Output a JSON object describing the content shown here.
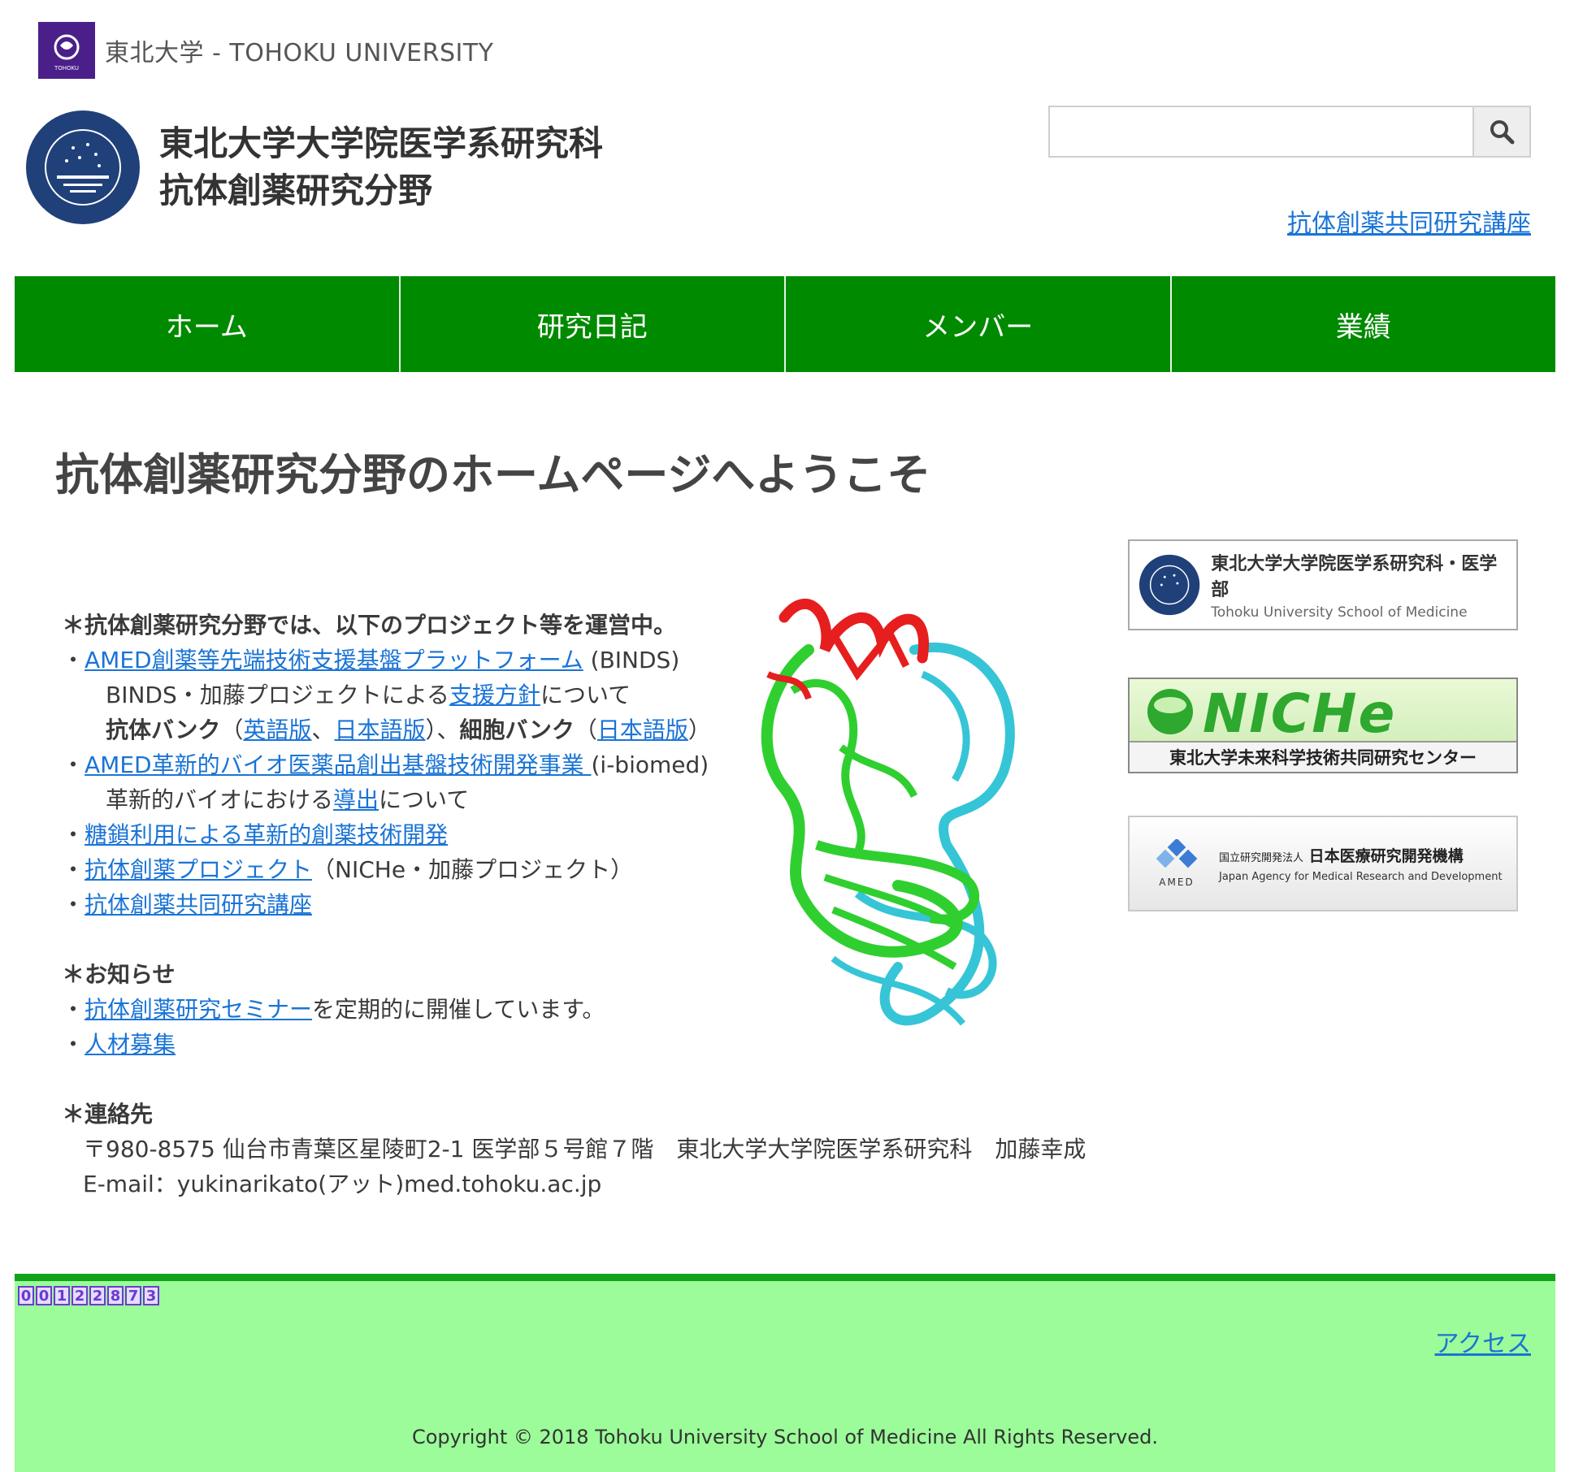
{
  "university": {
    "name": "東北大学 - TOHOKU UNIVERSITY",
    "logo_text": "TOHOKU"
  },
  "header": {
    "title_line1": "東北大学大学院医学系研究科",
    "title_line2": "抗体創薬研究分野",
    "search_placeholder": "",
    "search_value": "",
    "link": "抗体創薬共同研究講座"
  },
  "nav": [
    "ホーム",
    "研究日記",
    "メンバー",
    "業績"
  ],
  "welcome": "抗体創薬研究分野のホームページへようこそ",
  "projects": {
    "heading": "＊抗体創薬研究分野では、以下のプロジェクト等を運営中。",
    "binds_link": "AMED創薬等先端技術支援基盤プラットフォーム",
    "binds_suffix": " (BINDS)",
    "binds_sub_pre": "BINDS・加藤プロジェクトによる",
    "binds_sub_link": "支援方針",
    "binds_sub_post": "について",
    "ab_bank": "抗体バンク",
    "en_link": "英語版",
    "ja_link": "日本語版",
    "cell_bank": "細胞バンク",
    "ja_link2": "日本語版",
    "ibiomed_link": "AMED革新的バイオ医薬品創出基盤技術開発事業 ",
    "ibiomed_suffix": "(i-biomed)",
    "ibiomed_sub_pre": "革新的バイオにおける",
    "ibiomed_sub_link": "導出",
    "ibiomed_sub_post": "について",
    "glyco_link": "糖鎖利用による革新的創薬技術開発",
    "abproj_link": "抗体創薬プロジェクト",
    "abproj_suffix": "（NICHe・加藤プロジェクト）",
    "course_link": "抗体創薬共同研究講座"
  },
  "news": {
    "heading": "＊お知らせ",
    "seminar_link": "抗体創薬研究セミナー",
    "seminar_post": "を定期的に開催しています。",
    "recruit_link": "人材募集"
  },
  "contact": {
    "heading": "＊連絡先",
    "address": "〒980-8575 仙台市青葉区星陵町2-1 医学部５号館７階　東北大学大学院医学系研究科　加藤幸成",
    "email": "E-mail：yukinarikato(アット)med.tohoku.ac.jp"
  },
  "banners": {
    "med_title": "東北大学大学院医学系研究科・医学部",
    "med_sub": "Tohoku University School of Medicine",
    "niche_big": "NICHe",
    "niche_bar": "東北大学未来科学技術共同研究センター",
    "amed_label": "AMED",
    "amed_small": "国立研究開発法人",
    "amed_title": "日本医療研究開発機構",
    "amed_sub": "Japan Agency for Medical Research and Development"
  },
  "footer": {
    "counter": [
      "0",
      "0",
      "1",
      "2",
      "2",
      "8",
      "7",
      "3"
    ],
    "access": "アクセス",
    "copyright": "Copyright © 2018 Tohoku University School of Medicine All Rights Reserved."
  },
  "colors": {
    "nav": "#008a00",
    "footer": "#9bfc99",
    "link": "#1a74d6"
  }
}
